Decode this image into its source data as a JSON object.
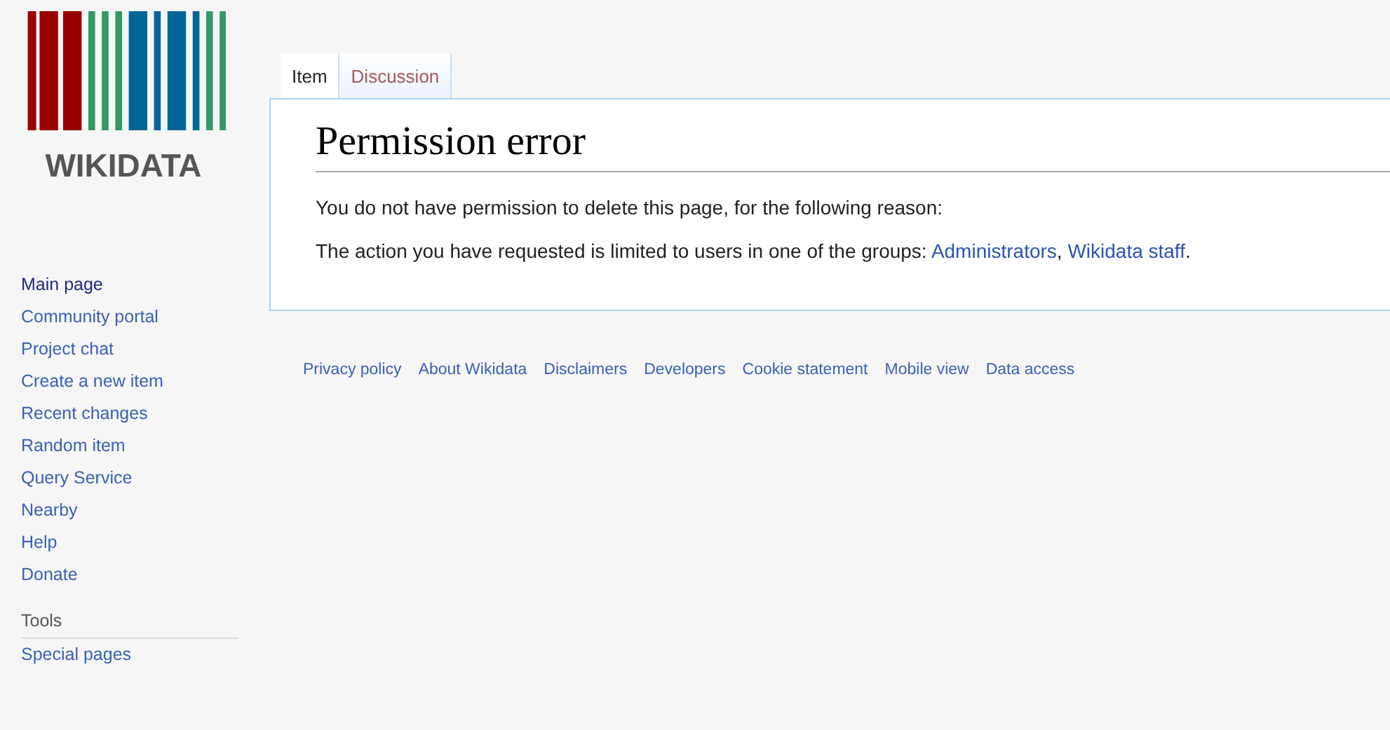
{
  "logo": {
    "text": "WIKIDATA"
  },
  "sidebar": {
    "items": [
      {
        "label": "Main page",
        "visited": true
      },
      {
        "label": "Community portal",
        "visited": false
      },
      {
        "label": "Project chat",
        "visited": false
      },
      {
        "label": "Create a new item",
        "visited": false
      },
      {
        "label": "Recent changes",
        "visited": false
      },
      {
        "label": "Random item",
        "visited": false
      },
      {
        "label": "Query Service",
        "visited": false
      },
      {
        "label": "Nearby",
        "visited": false
      },
      {
        "label": "Help",
        "visited": false
      },
      {
        "label": "Donate",
        "visited": false
      }
    ],
    "sections": [
      {
        "heading": "Tools",
        "items": [
          "Special pages"
        ]
      }
    ]
  },
  "tabs": [
    {
      "label": "Item",
      "selected": true
    },
    {
      "label": "Discussion",
      "selected": false
    }
  ],
  "heading": "Permission error",
  "message": "You do not have permission to delete this page, for the following reason:",
  "reason": {
    "text": "The action you have requested is limited to users in one of the groups:",
    "links": [
      {
        "text": "Administrators",
        "suffix": ","
      },
      {
        "text": "Wikidata staff",
        "suffix": "."
      }
    ]
  },
  "footer_links": [
    "Privacy policy",
    "About Wikidata",
    "Disclaimers",
    "Developers",
    "Cookie statement",
    "Mobile view",
    "Data access"
  ]
}
